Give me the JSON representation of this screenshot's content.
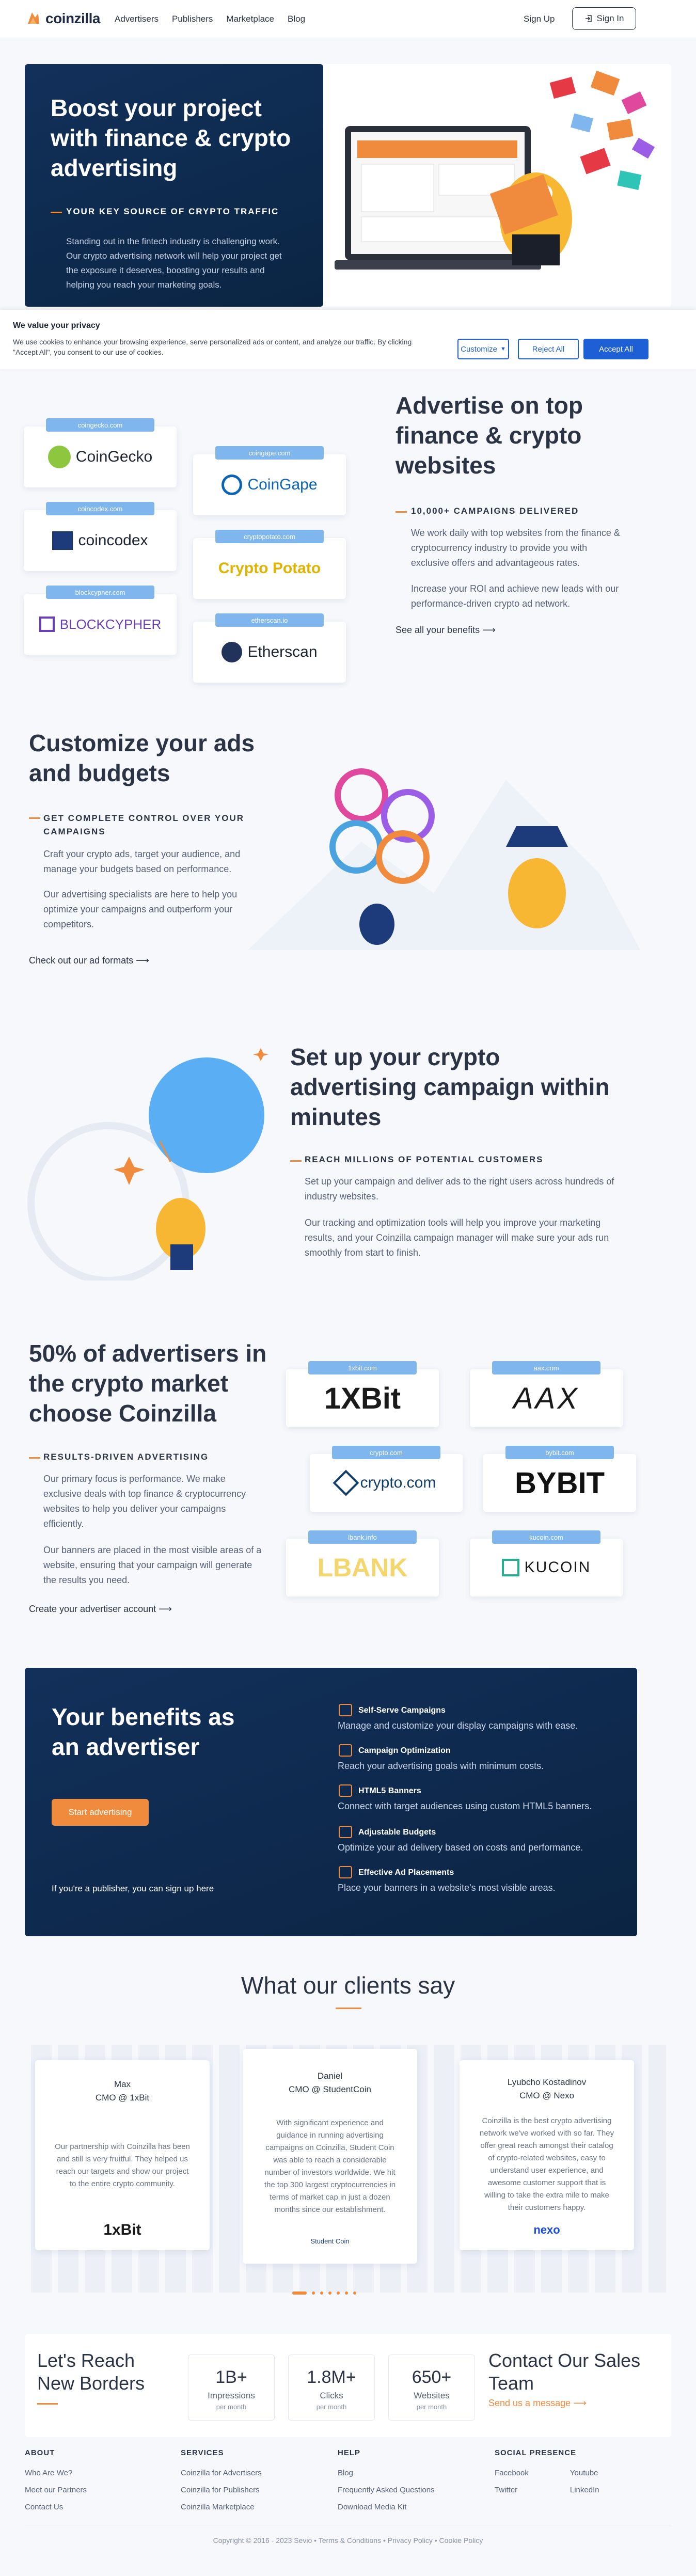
{
  "nav": {
    "logo": "coinzilla",
    "links": [
      "Advertisers",
      "Publishers",
      "Marketplace",
      "Blog"
    ],
    "signup": "Sign Up",
    "signin": "Sign In"
  },
  "hero": {
    "title": "Boost your project with finance & crypto advertising",
    "subtitle": "YOUR KEY SOURCE OF CRYPTO TRAFFIC",
    "text": "Standing out in the fintech industry is challenging work. Our crypto advertising network will help your project get the exposure it deserves, boosting your results and helping you reach your marketing goals."
  },
  "cookie": {
    "title": "We value your privacy",
    "text": "We use cookies to enhance your browsing experience, serve personalized ads or content, and analyze our traffic. By clicking \"Accept All\", you consent to our use of cookies.",
    "customize": "Customize",
    "reject": "Reject All",
    "accept": "Accept All"
  },
  "finance": {
    "title": "Advertise on top finance & crypto websites",
    "subtitle": "10,000+ CAMPAIGNS DELIVERED",
    "p1": "We work daily with top websites from the finance & cryptocurrency industry to provide you with exclusive offers and advantageous rates.",
    "p2": "Increase your ROI and achieve new leads with our performance-driven crypto ad network.",
    "link": "See all your benefits ⟶",
    "sites": [
      {
        "domain": "coingecko.com",
        "name": "CoinGecko"
      },
      {
        "domain": "coingape.com",
        "name": "CoinGape"
      },
      {
        "domain": "coincodex.com",
        "name": "coincodex"
      },
      {
        "domain": "cryptopotato.com",
        "name": "Crypto Potato"
      },
      {
        "domain": "blockcypher.com",
        "name": "BLOCKCYPHER"
      },
      {
        "domain": "etherscan.io",
        "name": "Etherscan"
      }
    ]
  },
  "customize": {
    "title": "Customize your ads and budgets",
    "subtitle": "GET COMPLETE CONTROL OVER YOUR CAMPAIGNS",
    "p1": "Craft your crypto ads, target your audience, and manage your budgets based on performance.",
    "p2": "Our advertising specialists are here to help you optimize your campaigns and outperform your competitors.",
    "link": "Check out our ad formats ⟶"
  },
  "setup": {
    "title": "Set up your crypto advertising campaign within minutes",
    "subtitle": "REACH MILLIONS OF POTENTIAL CUSTOMERS",
    "p1": "Set up your campaign and deliver ads to the right users across hundreds of industry websites.",
    "p2": "Our tracking and optimization tools will help you improve your marketing results, and your Coinzilla campaign manager will make sure your ads run smoothly from start to finish."
  },
  "advertisers": {
    "title": "50% of advertisers in the crypto market choose Coinzilla",
    "subtitle": "RESULTS-DRIVEN ADVERTISING",
    "p1": "Our primary focus is performance. We make exclusive deals with top finance & cryptocurrency websites to help you deliver your campaigns efficiently.",
    "p2": "Our banners are placed in the most visible areas of a website, ensuring that your campaign will generate the results you need.",
    "link": "Create your advertiser account ⟶",
    "brands": [
      {
        "domain": "1xbit.com",
        "name": "1XBit"
      },
      {
        "domain": "aax.com",
        "name": "AAX"
      },
      {
        "domain": "crypto.com",
        "name": "crypto.com"
      },
      {
        "domain": "bybit.com",
        "name": "BYBIT"
      },
      {
        "domain": "lbank.info",
        "name": "LBANK"
      },
      {
        "domain": "kucoin.com",
        "name": "KUCOIN"
      }
    ]
  },
  "benefits": {
    "title": "Your benefits as an advertiser",
    "button": "Start advertising",
    "publisher": "If you're a publisher, you can sign up here",
    "items": [
      {
        "title": "Self-Serve Campaigns",
        "desc": "Manage and customize your display campaigns with ease."
      },
      {
        "title": "Campaign Optimization",
        "desc": "Reach your advertising goals with minimum costs."
      },
      {
        "title": "HTML5 Banners",
        "desc": "Connect with target audiences using custom HTML5 banners."
      },
      {
        "title": "Adjustable Budgets",
        "desc": "Optimize your ad delivery based on costs and performance."
      },
      {
        "title": "Effective Ad Placements",
        "desc": "Place your banners in a website's most visible areas."
      }
    ]
  },
  "testimonials": {
    "title": "What our clients say",
    "items": [
      {
        "name": "Max",
        "role": "CMO @ 1xBit",
        "quote": "Our partnership with Coinzilla has been and still is very fruitful. They helped us reach our targets and show our project to the entire crypto community.",
        "brand": "1xBit"
      },
      {
        "name": "Daniel",
        "role": "CMO @ StudentCoin",
        "quote": "With significant experience and guidance in running advertising campaigns on Coinzilla, Student Coin was able to reach a considerable number of investors worldwide. We hit the top 300 largest cryptocurrencies in terms of market cap in just a dozen months since our establishment.",
        "brand": "Student Coin"
      },
      {
        "name": "Lyubcho Kostadinov",
        "role": "CMO @ Nexo",
        "quote": "Coinzilla is the best crypto advertising network we've worked with so far. They offer great reach amongst their catalog of crypto-related websites, easy to understand user experience, and awesome customer support that is willing to take the extra mile to make their customers happy.",
        "brand": "nexo"
      }
    ]
  },
  "cta": {
    "left_title": "Let's Reach New Borders",
    "right_title": "Contact Our Sales Team",
    "right_link": "Send us a message ⟶",
    "stats": [
      {
        "value": "1B+",
        "label": "Impressions",
        "unit": "per month"
      },
      {
        "value": "1.8M+",
        "label": "Clicks",
        "unit": "per month"
      },
      {
        "value": "650+",
        "label": "Websites",
        "unit": "per month"
      }
    ]
  },
  "footer": {
    "columns": [
      {
        "heading": "ABOUT",
        "links": [
          "Who Are We?",
          "Meet our Partners",
          "Contact Us"
        ]
      },
      {
        "heading": "SERVICES",
        "links": [
          "Coinzilla for Advertisers",
          "Coinzilla for Publishers",
          "Coinzilla Marketplace"
        ]
      },
      {
        "heading": "HELP",
        "links": [
          "Blog",
          "Frequently Asked Questions",
          "Download Media Kit"
        ]
      },
      {
        "heading": "SOCIAL PRESENCE",
        "links": [
          "Facebook",
          "Twitter",
          "Youtube",
          "LinkedIn"
        ]
      }
    ],
    "copyright": "Copyright © 2016 - 2023 Sevio • Terms & Conditions • Privacy Policy • Cookie Policy"
  },
  "colors": {
    "accent": "#f08a3c",
    "navy": "#0f2b50",
    "tag": "#7fb6ee",
    "primary_button": "#1f5fd6"
  }
}
